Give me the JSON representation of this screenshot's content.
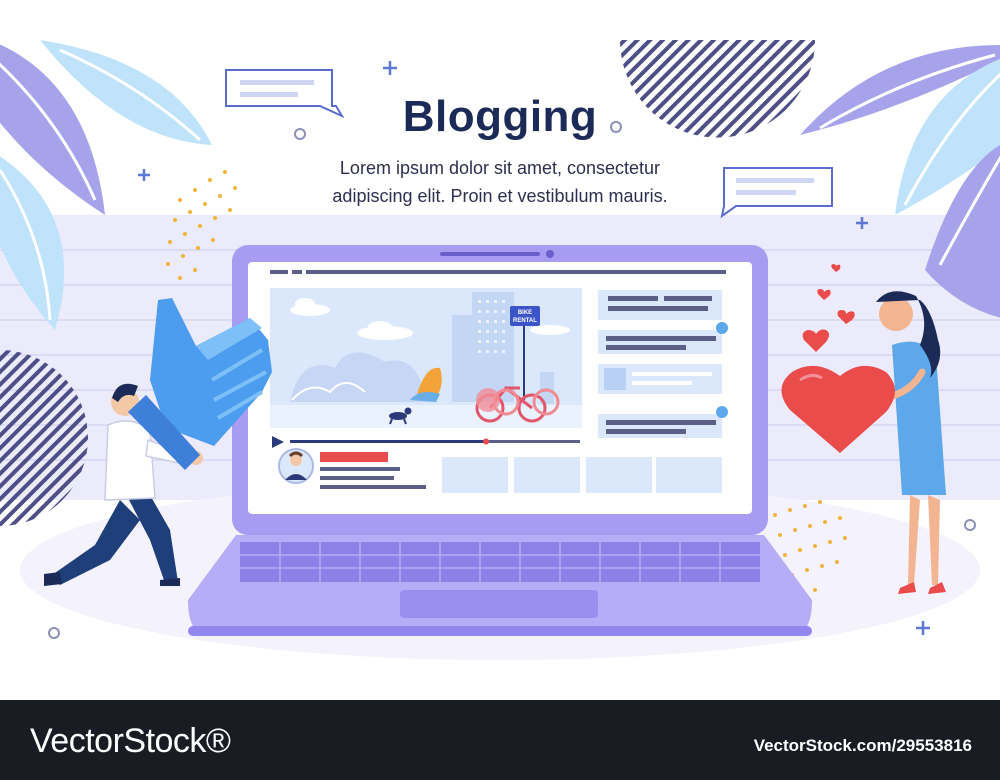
{
  "banner": {
    "title": "Blogging",
    "subtitle_line1": "Lorem ipsum dolor sit amet, consectetur",
    "subtitle_line2": "adipiscing elit. Proin et vestibulum mauris.",
    "sign_line1": "BIKE",
    "sign_line2": "RENTAL"
  },
  "footer": {
    "brand": "VectorStock®",
    "image_id": "VectorStock.com/29553816"
  },
  "colors": {
    "title": "#1c2a57",
    "laptop": "#a89bf2",
    "accent_red": "#ea4b4b",
    "leaf_blue": "#bfe3fa",
    "leaf_purple": "#a7a3ea",
    "footer_bg": "#191d23"
  },
  "icons": [
    "like-thumb-icon",
    "heart-icon",
    "play-icon",
    "chat-bubble-icon",
    "plus-sparkle-icon"
  ]
}
